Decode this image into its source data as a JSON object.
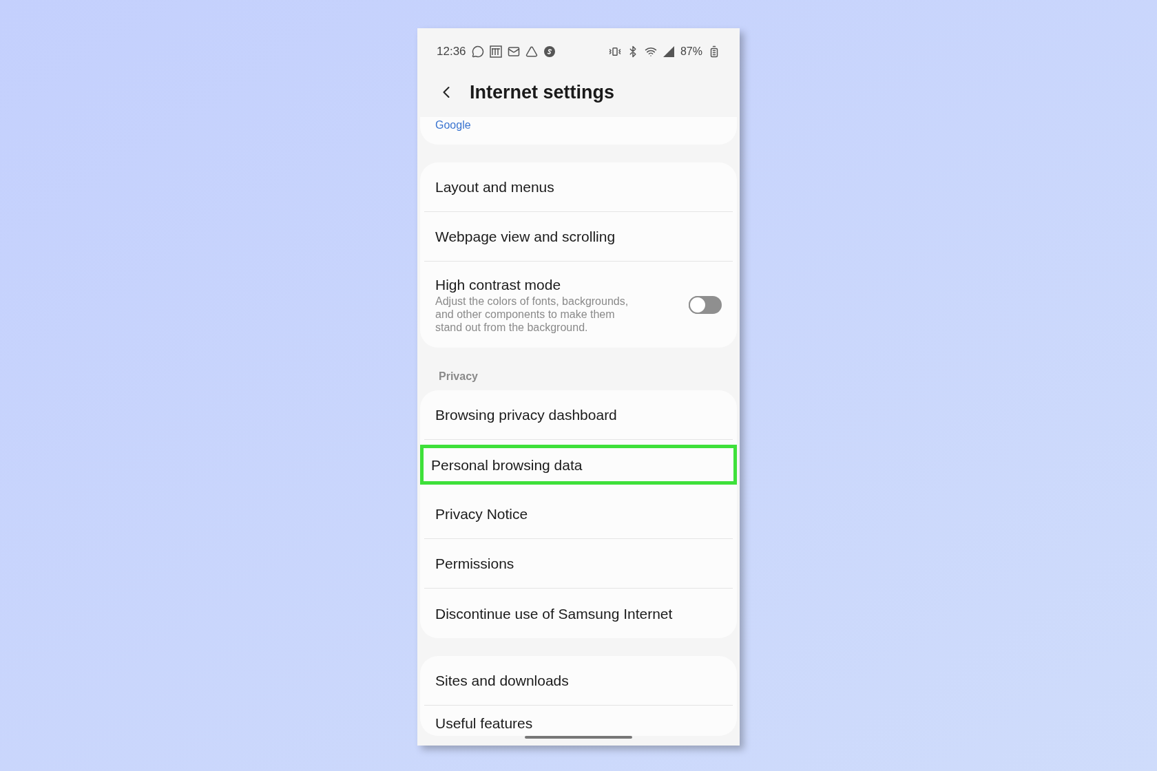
{
  "status_bar": {
    "time": "12:36",
    "battery": "87%"
  },
  "header": {
    "title": "Internet settings"
  },
  "sections": [
    {
      "items": [
        {
          "kind": "value",
          "label": "Google"
        }
      ]
    },
    {
      "items": [
        {
          "kind": "link",
          "label": "Layout and menus"
        },
        {
          "kind": "link",
          "label": "Webpage view and scrolling"
        },
        {
          "kind": "toggle",
          "label": "High contrast mode",
          "description": "Adjust the colors of fonts, backgrounds, and other components to make them stand out from the background.",
          "on": false
        }
      ]
    },
    {
      "heading": "Privacy",
      "items": [
        {
          "kind": "link",
          "label": "Browsing privacy dashboard"
        },
        {
          "kind": "link",
          "label": "Personal browsing data",
          "highlighted": true
        },
        {
          "kind": "link",
          "label": "Privacy Notice"
        },
        {
          "kind": "link",
          "label": "Permissions"
        },
        {
          "kind": "link",
          "label": "Discontinue use of Samsung Internet"
        }
      ]
    },
    {
      "items": [
        {
          "kind": "link",
          "label": "Sites and downloads"
        },
        {
          "kind": "link",
          "label": "Useful features"
        }
      ]
    }
  ]
}
